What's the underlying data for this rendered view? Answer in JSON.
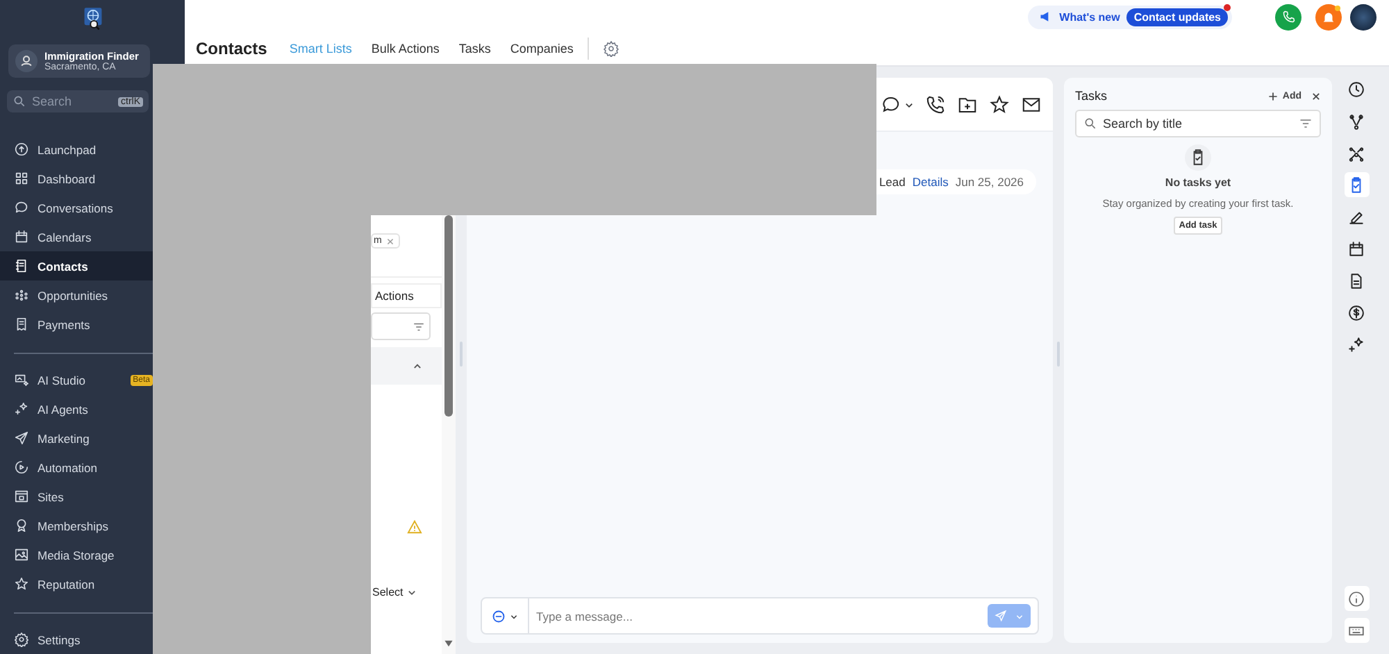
{
  "sidebar": {
    "account": {
      "name": "Immigration Finder",
      "location": "Sacramento, CA"
    },
    "search": {
      "placeholder": "Search",
      "shortcut": "ctrlK"
    },
    "nav_groups": [
      [
        {
          "label": "Launchpad",
          "selected": false
        },
        {
          "label": "Dashboard",
          "selected": false
        },
        {
          "label": "Conversations",
          "selected": false
        },
        {
          "label": "Calendars",
          "selected": false
        },
        {
          "label": "Contacts",
          "selected": true
        },
        {
          "label": "Opportunities",
          "selected": false
        },
        {
          "label": "Payments",
          "selected": false
        }
      ],
      [
        {
          "label": "AI Studio",
          "selected": false,
          "badge": "Beta"
        },
        {
          "label": "AI Agents",
          "selected": false
        },
        {
          "label": "Marketing",
          "selected": false
        },
        {
          "label": "Automation",
          "selected": false
        },
        {
          "label": "Sites",
          "selected": false
        },
        {
          "label": "Memberships",
          "selected": false
        },
        {
          "label": "Media Storage",
          "selected": false
        },
        {
          "label": "Reputation",
          "selected": false
        }
      ],
      [
        {
          "label": "Settings",
          "selected": false
        }
      ]
    ]
  },
  "header": {
    "title": "Contacts",
    "tabs": [
      {
        "label": "Smart Lists",
        "selected": true
      },
      {
        "label": "Bulk Actions",
        "selected": false
      },
      {
        "label": "Tasks",
        "selected": false
      },
      {
        "label": "Companies",
        "selected": false
      }
    ],
    "whats_new": {
      "label": "What's new",
      "badge": "Contact updates",
      "unread": true
    },
    "notifications_unread": true
  },
  "contact_list": {
    "chip": "m",
    "tab": "Actions",
    "select": "Select"
  },
  "conversation": {
    "tag": "Lead",
    "details_link": "Details",
    "date": "Jun 25, 2026",
    "composer": {
      "placeholder": "Type a message..."
    }
  },
  "tasks_panel": {
    "title": "Tasks",
    "add": "Add",
    "search": {
      "placeholder": "Search by title"
    },
    "empty_title": "No tasks yet",
    "empty_text": "Stay organized by creating your first task.",
    "add_button": "Add task"
  },
  "right_rail": [
    {
      "selected": false
    },
    {
      "selected": false
    },
    {
      "selected": false
    },
    {
      "selected": true
    },
    {
      "selected": false
    },
    {
      "selected": false
    },
    {
      "selected": false
    },
    {
      "selected": false
    },
    {
      "selected": false
    }
  ]
}
